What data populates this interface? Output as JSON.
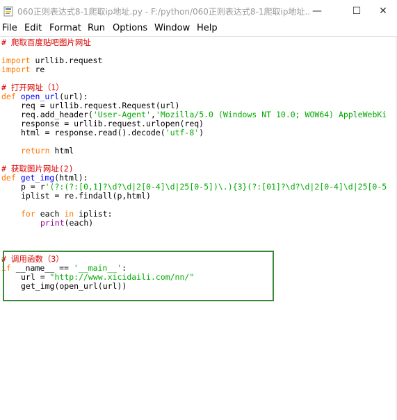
{
  "window": {
    "title": "060正则表达式8-1爬取ip地址.py - F:/python/060正则表达式8-1爬取ip地址....",
    "minimize": "—",
    "maximize": "☐",
    "close": "✕"
  },
  "menu": [
    "File",
    "Edit",
    "Format",
    "Run",
    "Options",
    "Window",
    "Help"
  ],
  "code": {
    "c1": "# 爬取百度贴吧图片网址",
    "imp1_kw": "import",
    "imp1_rest": " urllib.request",
    "imp2_kw": "import",
    "imp2_rest": " re",
    "c2": "# 打开网址（1）",
    "def1_kw": "def",
    "def1_name": " open_url",
    "def1_rest": "(url):",
    "l_req": "req = urllib.request.Request(url)",
    "l_hdr_a": "req.add_header(",
    "l_hdr_s1": "'User-Agent'",
    "l_hdr_b": ",",
    "l_hdr_s2": "'Mozilla/5.0 (Windows NT 10.0; WOW64) AppleWebKi",
    "l_resp": "response = urllib.request.urlopen(req)",
    "l_html_a": "html = response.read().decode(",
    "l_html_s": "'utf-8'",
    "l_html_b": ")",
    "ret_kw": "return",
    "ret_rest": " html",
    "c3": "# 获取图片网址(2)",
    "def2_kw": "def",
    "def2_name": " get_img",
    "def2_rest": "(html):",
    "p_a": "p = r",
    "p_s": "'(?:(?:[0,1]?\\d?\\d|2[0-4]\\d|25[0-5])\\.){3}(?:[01]?\\d?\\d|2[0-4]\\d|25[0-5",
    "l_iplist": "iplist = re.findall(p,html)",
    "for_kw": "for",
    "for_mid": " each ",
    "in_kw": "in",
    "for_rest": " iplist:",
    "print_bi": "print",
    "print_rest": "(each)",
    "c4": "# 调用函数（3）",
    "if_kw": "if",
    "if_mid": " __name__ == ",
    "if_s": "'__main__'",
    "if_b": ":",
    "url_a": "url = ",
    "url_s": "\"http://www.xicidaili.com/nn/\"",
    "l_call": "get_img(open_url(url))"
  }
}
